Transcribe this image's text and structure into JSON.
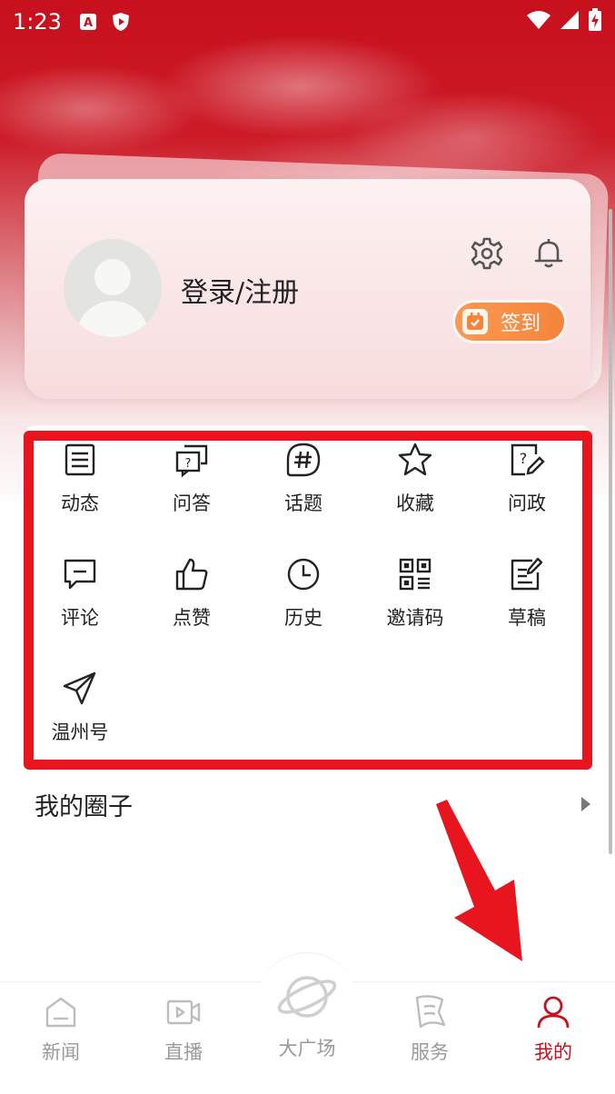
{
  "status_bar": {
    "time": "1:23",
    "icons": [
      "notification-a-icon",
      "shield-play-icon",
      "wifi-icon",
      "signal-icon",
      "battery-charging-icon"
    ]
  },
  "profile": {
    "login_text": "登录/注册",
    "signin_label": "签到",
    "icons": [
      "settings-icon",
      "bell-icon",
      "calendar-check-icon"
    ]
  },
  "menu": {
    "items": [
      {
        "label": "动态",
        "icon": "list-icon"
      },
      {
        "label": "问答",
        "icon": "qa-icon"
      },
      {
        "label": "话题",
        "icon": "hashtag-icon"
      },
      {
        "label": "收藏",
        "icon": "star-icon"
      },
      {
        "label": "问政",
        "icon": "question-edit-icon"
      },
      {
        "label": "评论",
        "icon": "comment-icon"
      },
      {
        "label": "点赞",
        "icon": "thumb-up-icon"
      },
      {
        "label": "历史",
        "icon": "clock-icon"
      },
      {
        "label": "邀请码",
        "icon": "qr-code-icon"
      },
      {
        "label": "草稿",
        "icon": "draft-icon"
      },
      {
        "label": "温州号",
        "icon": "paper-plane-icon"
      }
    ]
  },
  "circle": {
    "title": "我的圈子"
  },
  "bottom_nav": {
    "items": [
      {
        "label": "新闻",
        "icon": "news-icon",
        "active": false
      },
      {
        "label": "直播",
        "icon": "video-icon",
        "active": false
      },
      {
        "label": "大广场",
        "icon": "planet-icon",
        "active": false
      },
      {
        "label": "服务",
        "icon": "flag-icon",
        "active": false
      },
      {
        "label": "我的",
        "icon": "user-icon",
        "active": true
      }
    ]
  },
  "colors": {
    "brand_red": "#c8101d",
    "highlight_red": "#e8141e",
    "signin_orange": "#f6843b",
    "inactive_gray": "#9a9a9a"
  }
}
